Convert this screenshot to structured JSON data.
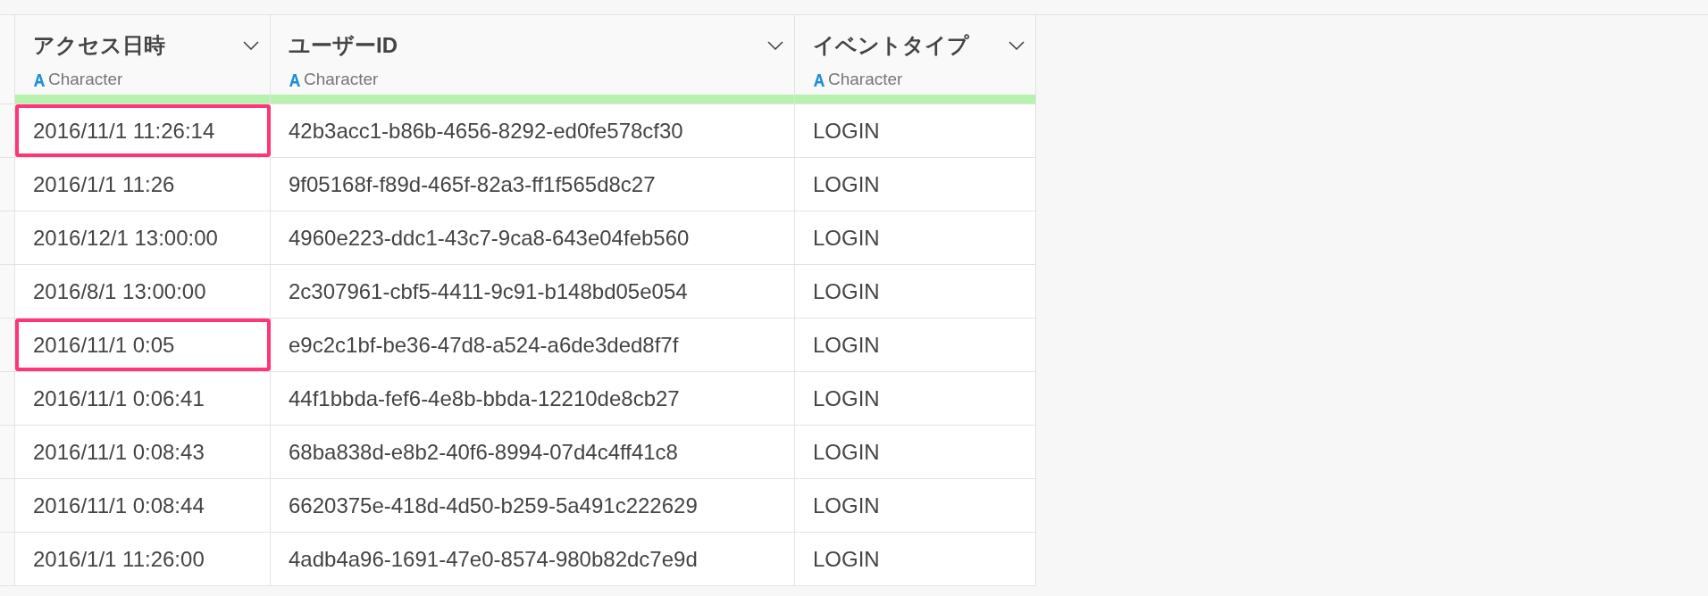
{
  "table": {
    "columns": [
      {
        "name": "アクセス日時",
        "type": "Character"
      },
      {
        "name": "ユーザーID",
        "type": "Character"
      },
      {
        "name": "イベントタイプ",
        "type": "Character"
      }
    ],
    "rows": [
      {
        "cells": [
          "2016/11/1 11:26:14",
          "42b3acc1-b86b-4656-8292-ed0fe578cf30",
          "LOGIN"
        ],
        "highlighted": true
      },
      {
        "cells": [
          "2016/1/1 11:26",
          "9f05168f-f89d-465f-82a3-ff1f565d8c27",
          "LOGIN"
        ],
        "highlighted": false
      },
      {
        "cells": [
          "2016/12/1 13:00:00",
          "4960e223-ddc1-43c7-9ca8-643e04feb560",
          "LOGIN"
        ],
        "highlighted": false
      },
      {
        "cells": [
          "2016/8/1 13:00:00",
          "2c307961-cbf5-4411-9c91-b148bd05e054",
          "LOGIN"
        ],
        "highlighted": false
      },
      {
        "cells": [
          "2016/11/1 0:05",
          "e9c2c1bf-be36-47d8-a524-a6de3ded8f7f",
          "LOGIN"
        ],
        "highlighted": true
      },
      {
        "cells": [
          "2016/11/1 0:06:41",
          "44f1bbda-fef6-4e8b-bbda-12210de8cb27",
          "LOGIN"
        ],
        "highlighted": false
      },
      {
        "cells": [
          "2016/11/1 0:08:43",
          "68ba838d-e8b2-40f6-8994-07d4c4ff41c8",
          "LOGIN"
        ],
        "highlighted": false
      },
      {
        "cells": [
          "2016/11/1 0:08:44",
          "6620375e-418d-4d50-b259-5a491c222629",
          "LOGIN"
        ],
        "highlighted": false
      },
      {
        "cells": [
          "2016/1/1 11:26:00",
          "4adb4a96-1691-47e0-8574-980b82dc7e9d",
          "LOGIN"
        ],
        "highlighted": false
      }
    ]
  }
}
